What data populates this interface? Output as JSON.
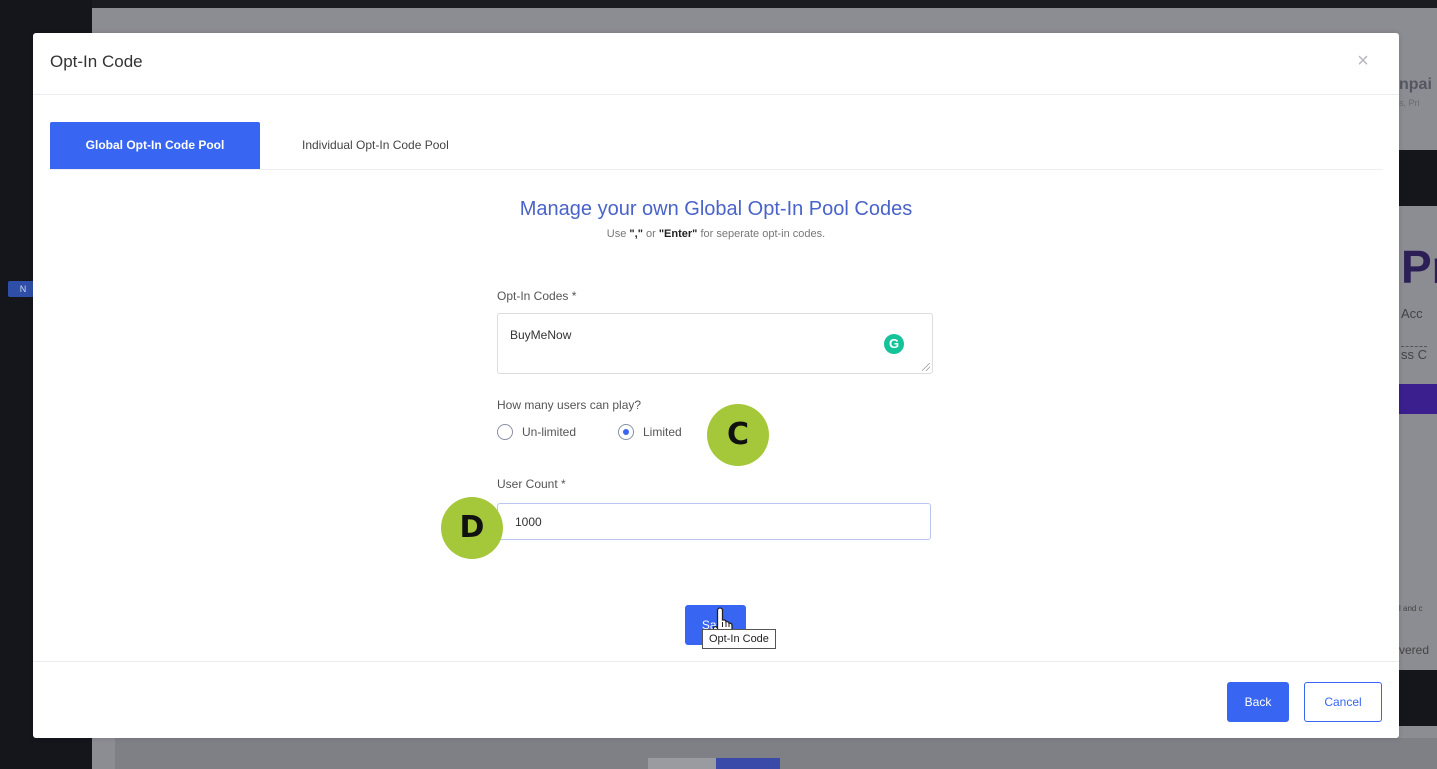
{
  "background": {
    "sidebar_badge": "N",
    "right_fragments": {
      "title_fragment": "npai",
      "subtitle_fragment": "s, Pri",
      "big_letter": "Pr",
      "line1": "Acc",
      "line2": "ss C",
      "small_text": "l and c",
      "line3": "vered"
    }
  },
  "modal": {
    "title": "Opt-In Code",
    "close_icon": "×",
    "tabs": [
      {
        "label": "Global Opt-In Code Pool",
        "active": true
      },
      {
        "label": "Individual Opt-In Code Pool",
        "active": false
      }
    ],
    "heading": "Manage your own Global Opt-In Pool Codes",
    "subheading": {
      "prefix": "Use ",
      "key1": "\",\"",
      "middle": " or ",
      "key2": "\"Enter\"",
      "suffix": " for seperate opt-in codes."
    },
    "opt_in_codes": {
      "label": "Opt-In Codes *",
      "value": "BuyMeNow"
    },
    "users_question": {
      "label": "How many users can play?",
      "options": [
        {
          "label": "Un-limited",
          "checked": false
        },
        {
          "label": "Limited",
          "checked": true
        }
      ]
    },
    "user_count": {
      "label": "User Count *",
      "value": "1000"
    },
    "save_label": "Save",
    "footer": {
      "back_label": "Back",
      "cancel_label": "Cancel"
    }
  },
  "annotations": {
    "marker_c": "C",
    "marker_d": "D"
  },
  "tooltip": "Opt-In Code",
  "colors": {
    "primary": "#3866f2",
    "heading": "#4a63c8",
    "marker": "#a4c83a",
    "grammarly": "#15c39a"
  }
}
